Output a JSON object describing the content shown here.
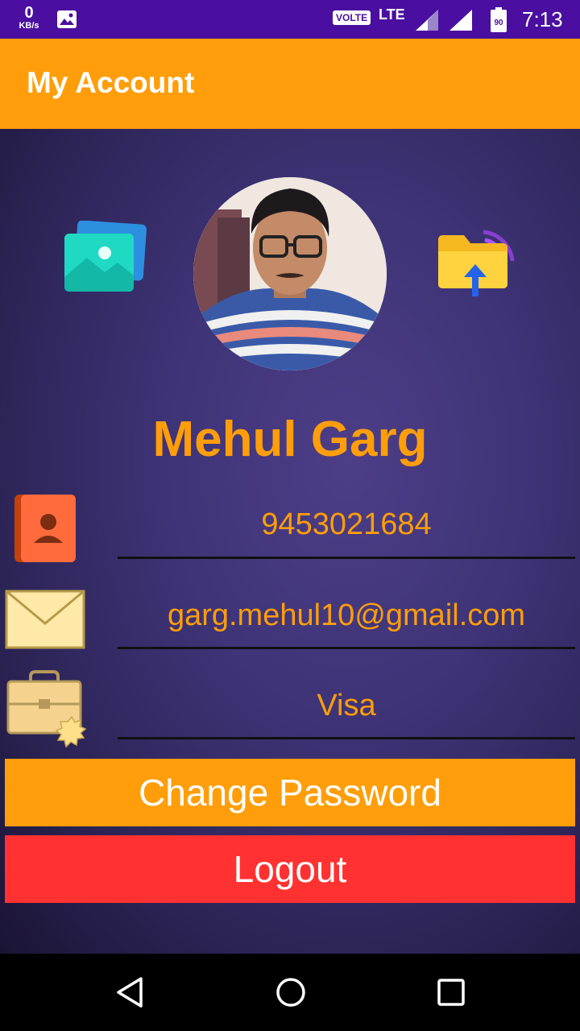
{
  "status_bar": {
    "speed_value": "0",
    "speed_unit": "KB/s",
    "volte": "VOLTE",
    "network": "LTE",
    "battery": "90",
    "time": "7:13"
  },
  "app_bar": {
    "title": "My Account"
  },
  "profile": {
    "name": "Mehul Garg",
    "phone": "9453021684",
    "email": "garg.mehul10@gmail.com",
    "card": "Visa"
  },
  "buttons": {
    "change_password": "Change Password",
    "logout": "Logout"
  },
  "colors": {
    "accent": "#ff9e0a",
    "danger": "#ff3131",
    "status_bar": "#4a0fa0"
  },
  "icons": [
    "photo-gallery-icon",
    "folder-upload-icon",
    "contact-book-icon",
    "envelope-icon",
    "briefcase-icon"
  ]
}
